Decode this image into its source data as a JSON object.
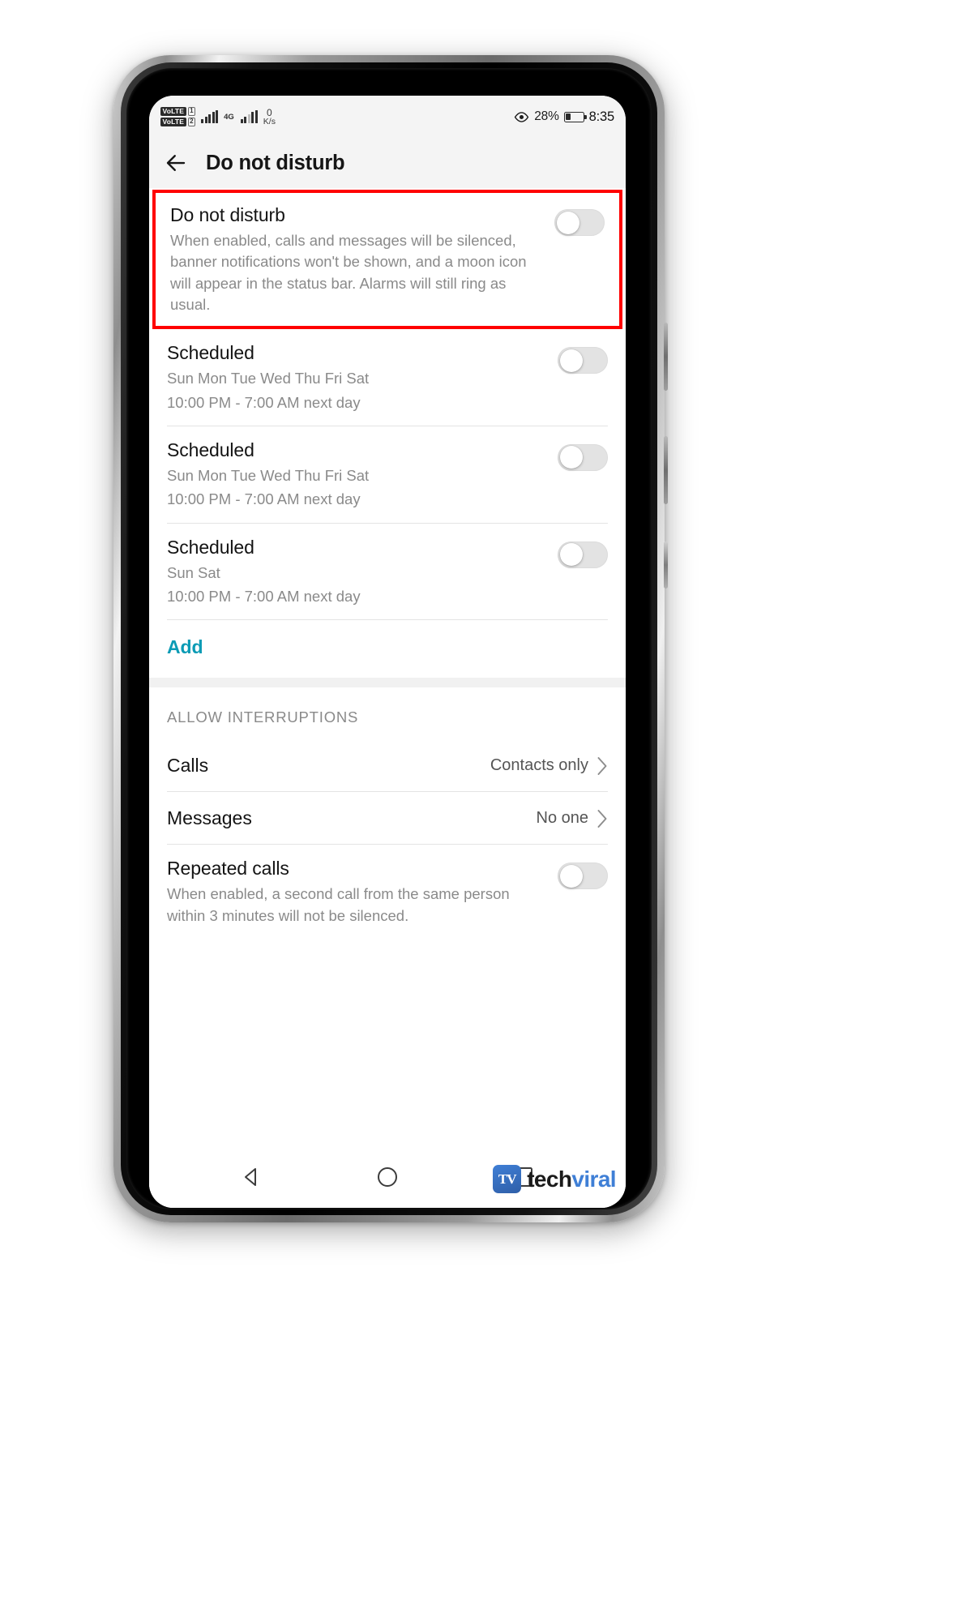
{
  "status_bar": {
    "volte_1": "VoLTE",
    "volte_2": "VoLTE",
    "sim_1": "1",
    "sim_2": "2",
    "network_type": "4G",
    "data_rate_value": "0",
    "data_rate_unit": "K/s",
    "eye_comfort_icon": "eye-icon",
    "battery_percent": "28%",
    "time": "8:35"
  },
  "app_bar": {
    "back_icon": "back-arrow-icon",
    "title": "Do not disturb"
  },
  "dnd_card": {
    "title": "Do not disturb",
    "description": "When enabled, calls and messages will be silenced, banner notifications won't be shown, and a moon icon will appear in the status bar. Alarms will still ring as usual.",
    "toggle_state": "off",
    "highlight_color": "#ff0000"
  },
  "schedules": [
    {
      "title": "Scheduled",
      "days": "Sun Mon Tue Wed Thu Fri Sat",
      "time_range": "10:00 PM - 7:00 AM next day",
      "toggle_state": "off"
    },
    {
      "title": "Scheduled",
      "days": "Sun Mon Tue Wed Thu Fri Sat",
      "time_range": "10:00 PM - 7:00 AM next day",
      "toggle_state": "off"
    },
    {
      "title": "Scheduled",
      "days": "Sun Sat",
      "time_range": "10:00 PM - 7:00 AM next day",
      "toggle_state": "off"
    }
  ],
  "add_button": {
    "label": "Add",
    "color": "#0b9bb5"
  },
  "allow_interruptions": {
    "section_label": "ALLOW INTERRUPTIONS",
    "calls": {
      "label": "Calls",
      "value": "Contacts only",
      "chevron": "chevron-right-icon"
    },
    "messages": {
      "label": "Messages",
      "value": "No one",
      "chevron": "chevron-right-icon"
    },
    "repeated_calls": {
      "label": "Repeated calls",
      "description": "When enabled, a second call from the same person within 3 minutes will not be silenced.",
      "toggle_state": "off"
    }
  },
  "navigation_bar": {
    "back": "nav-back-icon",
    "home": "nav-home-icon",
    "recents": "nav-recents-icon"
  },
  "watermark": {
    "logo_text": "TV",
    "name_part1": "tech",
    "name_part2": "viral"
  }
}
